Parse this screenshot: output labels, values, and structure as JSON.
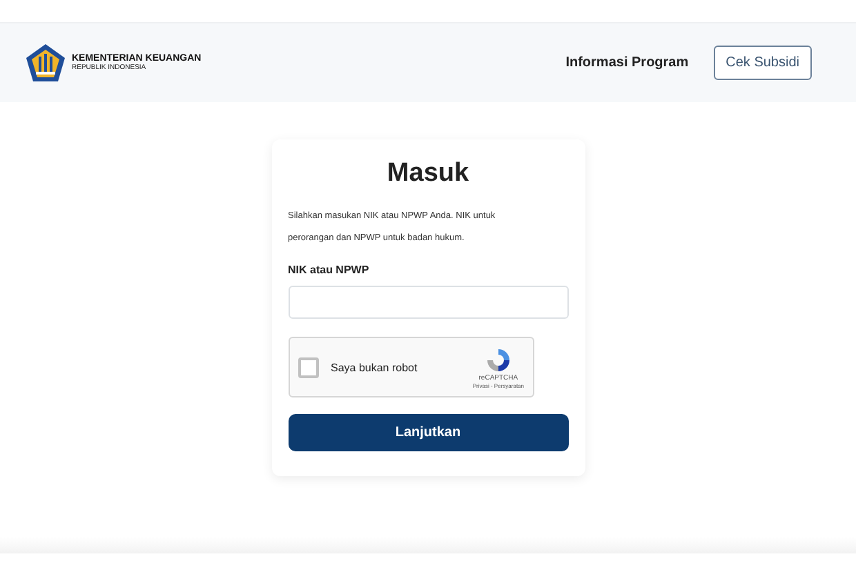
{
  "header": {
    "logo_title": "KEMENTERIAN KEUANGAN",
    "logo_subtitle": "REPUBLIK INDONESIA",
    "nav_link": "Informasi Program",
    "nav_button": "Cek Subsidi"
  },
  "login": {
    "title": "Masuk",
    "description": "Silahkan masukan NIK atau NPWP Anda. NIK untuk perorangan dan NPWP untuk badan hukum.",
    "field_label": "NIK atau NPWP",
    "captcha": {
      "label": "Saya bukan robot",
      "checked": false,
      "brand": "reCAPTCHA",
      "links": "Privasi - Persyaratan"
    },
    "submit": "Lanjutkan"
  }
}
